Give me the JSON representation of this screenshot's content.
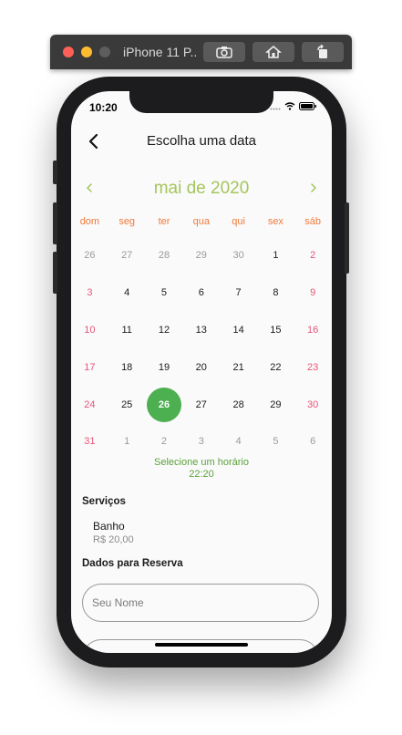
{
  "simulator": {
    "title": "iPhone 11 P..."
  },
  "status_bar": {
    "time": "10:20"
  },
  "appbar": {
    "title": "Escolha uma data"
  },
  "calendar": {
    "month_label": "mai de 2020",
    "weekdays": [
      "dom",
      "seg",
      "ter",
      "qua",
      "qui",
      "sex",
      "sáb"
    ],
    "weeks": [
      [
        "26",
        "27",
        "28",
        "29",
        "30",
        "1",
        "2"
      ],
      [
        "3",
        "4",
        "5",
        "6",
        "7",
        "8",
        "9"
      ],
      [
        "10",
        "11",
        "12",
        "13",
        "14",
        "15",
        "16"
      ],
      [
        "17",
        "18",
        "19",
        "20",
        "21",
        "22",
        "23"
      ],
      [
        "24",
        "25",
        "26",
        "27",
        "28",
        "29",
        "30"
      ],
      [
        "31",
        "1",
        "2",
        "3",
        "4",
        "5",
        "6"
      ]
    ],
    "selected_day": "26",
    "accent_color": "#a4c65a",
    "weekday_color": "#ef7a3c",
    "weekend_color": "#e8557a",
    "selected_color": "#4caf50"
  },
  "time_picker": {
    "label": "Selecione um horário",
    "time": "22:20"
  },
  "services": {
    "title": "Serviços",
    "item_name": "Banho",
    "item_price": "R$  20,00"
  },
  "reservation": {
    "title": "Dados para Reserva",
    "name_placeholder": "Seu Nome"
  }
}
